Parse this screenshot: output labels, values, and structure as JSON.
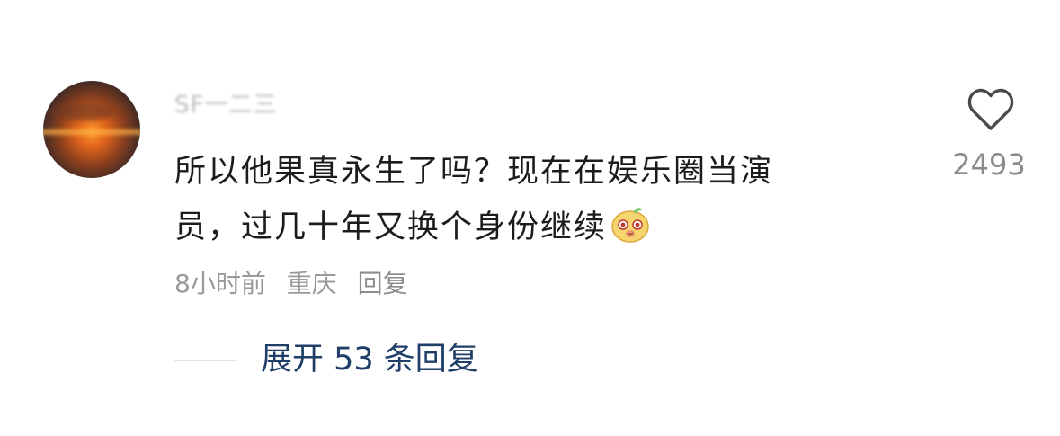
{
  "comment": {
    "username": "SF一二三",
    "text_line1": "所以他果真永生了吗？现在在娱乐圈当演",
    "text_line2": "员，过几十年又换个身份继续",
    "emoji_icon": "smiling-face-emoji",
    "time": "8小时前",
    "location": "重庆",
    "reply_label": "回复",
    "like_icon": "heart-outline-icon",
    "like_count": "2493",
    "expand_label": "展开 53 条回复"
  },
  "colors": {
    "text": "#1c1c1c",
    "meta": "#9a9a9a",
    "link": "#1f3e68",
    "like_count": "#8a8a8a"
  }
}
